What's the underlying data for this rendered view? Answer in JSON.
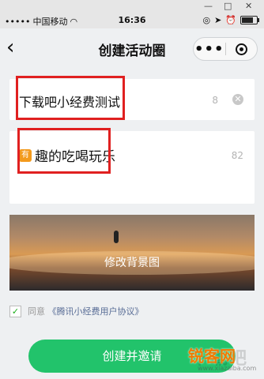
{
  "window": {
    "minimize": "—",
    "maximize": "□",
    "close": "✕"
  },
  "status_bar": {
    "carrier": "中国移动",
    "time": "16:36",
    "battery_level": 0.9
  },
  "nav": {
    "title": "创建活动圈",
    "more_icon": "•••"
  },
  "name_field": {
    "value": "下载吧小经费测试",
    "remaining": "8"
  },
  "desc_field": {
    "emoji": "有",
    "value": "趣的吃喝玩乐",
    "remaining": "82"
  },
  "banner": {
    "label": "修改背景图"
  },
  "agreement": {
    "prefix": "同意",
    "link": "《腾讯小经费用户协议》",
    "checked": true
  },
  "create_button": {
    "label": "创建并邀请"
  },
  "watermark": {
    "text": "下载吧",
    "brand": "锐客网",
    "url": "www.xiazaiba.com"
  }
}
